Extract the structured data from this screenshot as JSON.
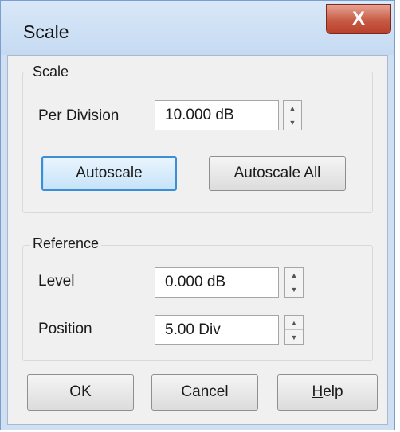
{
  "window": {
    "title": "Scale",
    "close_label": "X"
  },
  "scale_group": {
    "label": "Scale",
    "per_division_label": "Per Division",
    "per_division_value": "10.000 dB",
    "autoscale_label": "Autoscale",
    "autoscale_all_label": "Autoscale All"
  },
  "reference_group": {
    "label": "Reference",
    "level_label": "Level",
    "level_value": "0.000 dB",
    "position_label": "Position",
    "position_value": "5.00 Div"
  },
  "buttons": {
    "ok_label": "OK",
    "cancel_label": "Cancel",
    "help_first": "H",
    "help_rest": "elp"
  },
  "spinner_glyphs": {
    "up": "▲",
    "down": "▼"
  }
}
